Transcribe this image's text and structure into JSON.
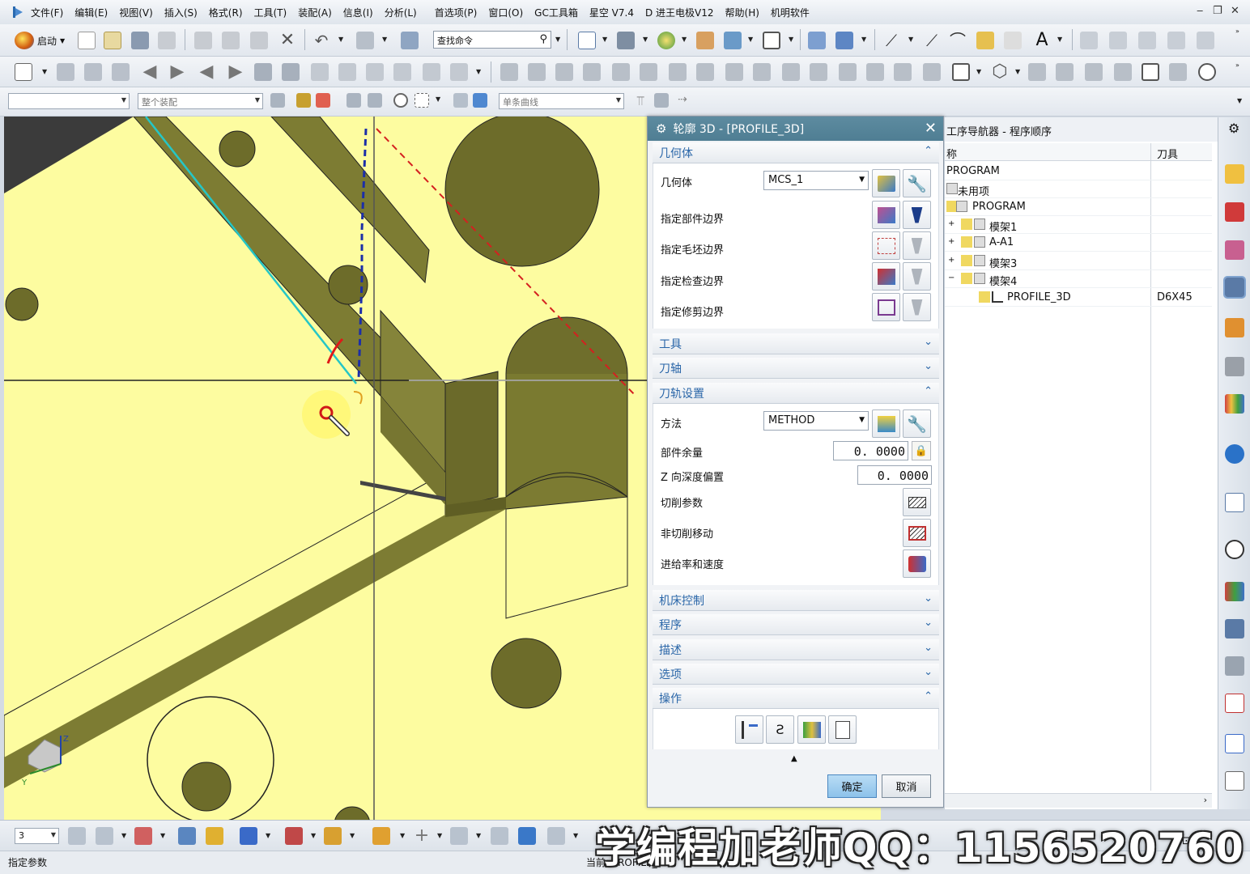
{
  "menu": {
    "items": [
      "文件(F)",
      "编辑(E)",
      "视图(V)",
      "插入(S)",
      "格式(R)",
      "工具(T)",
      "装配(A)",
      "信息(I)",
      "分析(L)",
      "首选项(P)",
      "窗口(O)",
      "GC工具箱",
      "星空 V7.4",
      "D 进王电极V12",
      "帮助(H)",
      "机明软件"
    ]
  },
  "toolbar": {
    "start_label": "启动",
    "find_command_placeholder": "查找命令",
    "assembly_filter": "整个装配",
    "curve_rule": "单条曲线",
    "selection_filter": ""
  },
  "dialog": {
    "title": "轮廓 3D - [PROFILE_3D]",
    "groups": {
      "geometry": "几何体",
      "tool": "工具",
      "axis": "刀轴",
      "path_settings": "刀轨设置",
      "machine_control": "机床控制",
      "program": "程序",
      "description": "描述",
      "options": "选项",
      "actions": "操作"
    },
    "geometry_label": "几何体",
    "geometry_value": "MCS_1",
    "specify_part_boundary": "指定部件边界",
    "specify_blank_boundary": "指定毛坯边界",
    "specify_check_boundary": "指定检查边界",
    "specify_trim_boundary": "指定修剪边界",
    "method_label": "方法",
    "method_value": "METHOD",
    "part_stock_label": "部件余量",
    "part_stock_value": "0. 0000",
    "z_depth_offset_label": "Z 向深度偏置",
    "z_depth_offset_value": "0. 0000",
    "cut_params_label": "切削参数",
    "non_cutting_label": "非切削移动",
    "feeds_speeds_label": "进给率和速度",
    "ok": "确定",
    "cancel": "取消"
  },
  "navigator": {
    "title": "工序导航器 - 程序顺序",
    "col_name": "称",
    "col_tool": "刀具",
    "rows": [
      {
        "name": "PROGRAM",
        "tool": ""
      },
      {
        "name": "未用项",
        "tool": ""
      },
      {
        "name": "PROGRAM",
        "tool": ""
      },
      {
        "name": "模架1",
        "tool": ""
      },
      {
        "name": "A-A1",
        "tool": ""
      },
      {
        "name": "模架3",
        "tool": ""
      },
      {
        "name": "模架4",
        "tool": ""
      },
      {
        "name": "PROFILE_3D",
        "tool": "D6X45"
      }
    ]
  },
  "bottom": {
    "layer_value": "3"
  },
  "status": {
    "prompt": "指定参数",
    "current": "当前: PROFILE_3D"
  },
  "watermark": "学编程加老师QQ：1156520760",
  "colors": {
    "part_face": "#fdfca0",
    "wall": "#7d7c33",
    "dialog_title": "#4f7e93",
    "group_title": "#2a66a8",
    "ok_button": "#8dc2ea"
  }
}
